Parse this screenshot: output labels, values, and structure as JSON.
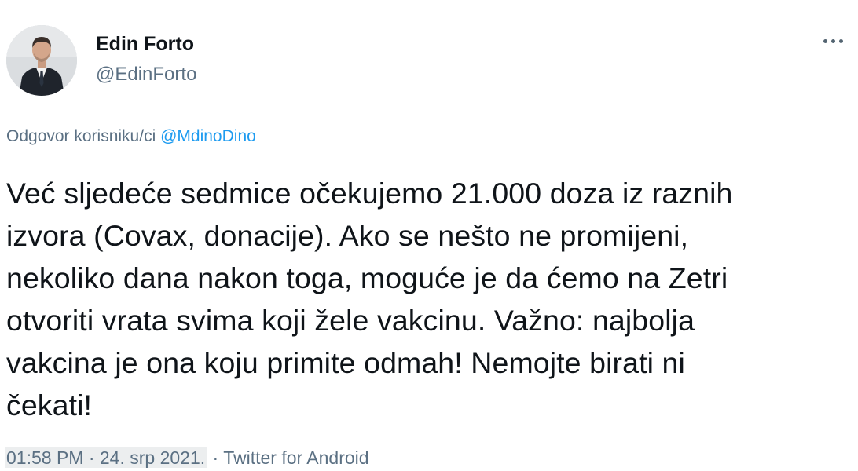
{
  "author": {
    "display_name": "Edin Forto",
    "handle": "@EdinForto"
  },
  "reply": {
    "prefix": "Odgovor korisniku/ci",
    "mention": "@MdinoDino"
  },
  "tweet": {
    "lines": [
      "Već sljedeće sedmice očekujemo 21.000 doza iz raznih",
      "izvora (Covax, donacije). Ako se nešto ne promijeni,",
      "nekoliko dana nakon toga, moguće je da ćemo na Zetri",
      "otvoriti vrata svima koji žele vakcinu. Važno: najbolja",
      "vakcina je ona koju primite odmah! Nemojte birati ni",
      "čekati!"
    ]
  },
  "footer": {
    "timestamp": "01:58 PM · 24. srp 2021.",
    "separator": "·",
    "source": "Twitter for Android"
  },
  "icons": {
    "more": "more-horizontal-icon"
  },
  "colors": {
    "secondary_text": "#5b7083",
    "link": "#1d9bf0",
    "primary_text": "#0f1419"
  }
}
